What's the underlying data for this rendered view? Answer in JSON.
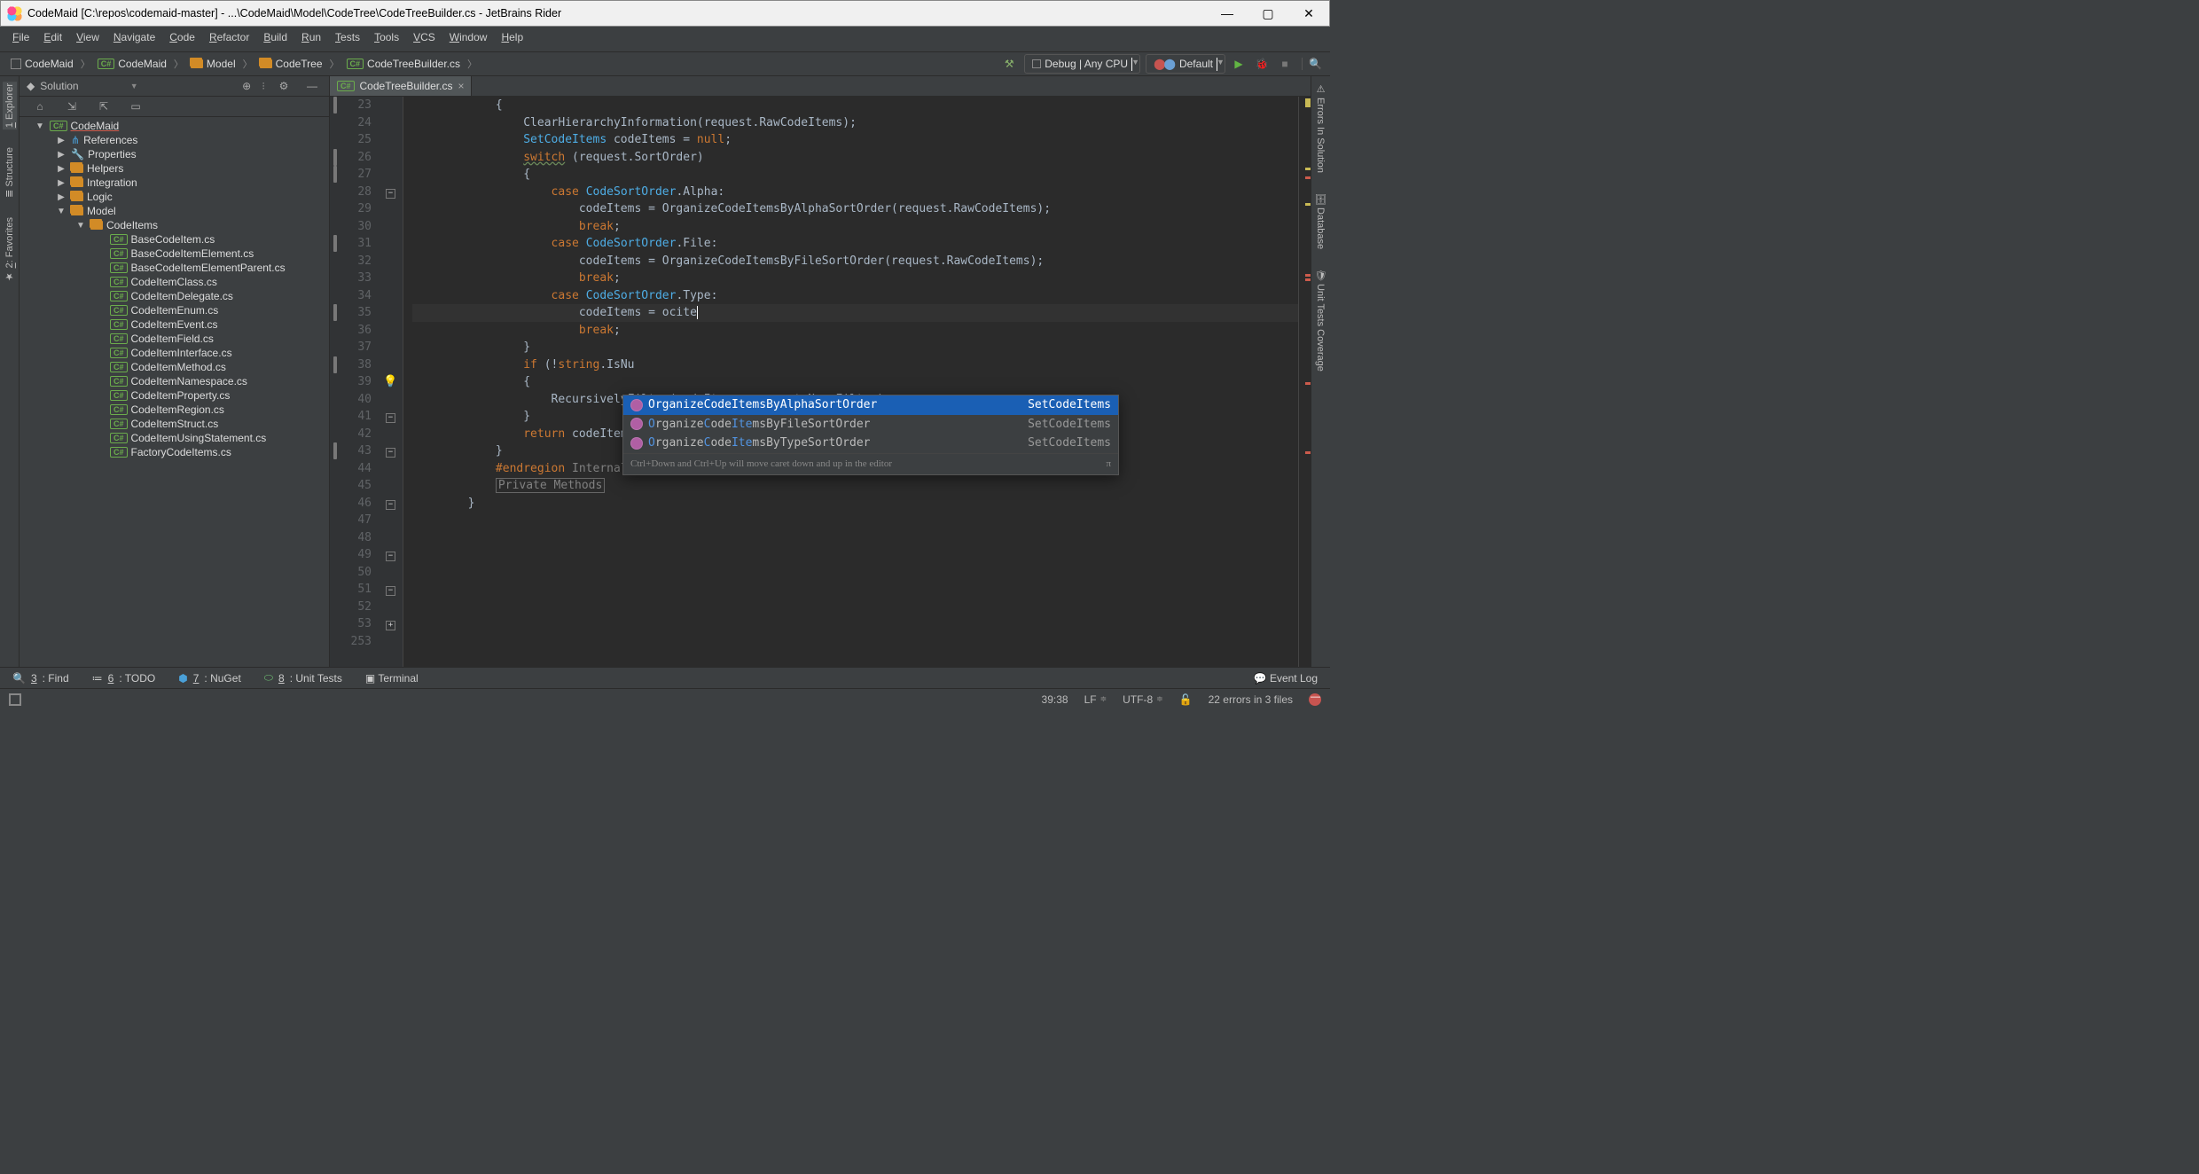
{
  "window": {
    "title": "CodeMaid [C:\\repos\\codemaid-master] - ...\\CodeMaid\\Model\\CodeTree\\CodeTreeBuilder.cs - JetBrains Rider"
  },
  "menu": [
    "File",
    "Edit",
    "View",
    "Navigate",
    "Code",
    "Refactor",
    "Build",
    "Run",
    "Tests",
    "Tools",
    "VCS",
    "Window",
    "Help"
  ],
  "breadcrumbs": [
    {
      "icon": "solution",
      "text": "CodeMaid"
    },
    {
      "icon": "cs",
      "text": "CodeMaid"
    },
    {
      "icon": "folder",
      "text": "Model"
    },
    {
      "icon": "folder",
      "text": "CodeTree"
    },
    {
      "icon": "cs",
      "text": "CodeTreeBuilder.cs"
    }
  ],
  "runconfig": {
    "config": "Debug | Any CPU",
    "profile": "Default"
  },
  "left_tools": {
    "explorer": "1: Explorer",
    "structure": "Structure",
    "favorites": "2: Favorites"
  },
  "right_tools": {
    "errors": "Errors In Solution",
    "database": "Database",
    "coverage": "Unit Tests Coverage"
  },
  "solution": {
    "title": "Solution",
    "root": "CodeMaid",
    "nodes": [
      {
        "d": 1,
        "a": "closed",
        "ico": "ref",
        "t": "References"
      },
      {
        "d": 1,
        "a": "closed",
        "ico": "prop",
        "t": "Properties"
      },
      {
        "d": 1,
        "a": "closed",
        "ico": "folder",
        "t": "Helpers"
      },
      {
        "d": 1,
        "a": "closed",
        "ico": "folder",
        "t": "Integration"
      },
      {
        "d": 1,
        "a": "closed",
        "ico": "folder",
        "t": "Logic"
      },
      {
        "d": 1,
        "a": "open",
        "ico": "folder",
        "t": "Model"
      },
      {
        "d": 2,
        "a": "open",
        "ico": "folder",
        "t": "CodeItems"
      },
      {
        "d": 3,
        "ico": "cs",
        "t": "BaseCodeItem.cs"
      },
      {
        "d": 3,
        "ico": "cs",
        "t": "BaseCodeItemElement.cs"
      },
      {
        "d": 3,
        "ico": "cs",
        "t": "BaseCodeItemElementParent.cs"
      },
      {
        "d": 3,
        "ico": "cs",
        "t": "CodeItemClass.cs"
      },
      {
        "d": 3,
        "ico": "cs",
        "t": "CodeItemDelegate.cs"
      },
      {
        "d": 3,
        "ico": "cs",
        "t": "CodeItemEnum.cs",
        "mark": true,
        "marky": 362
      },
      {
        "d": 3,
        "ico": "cs",
        "t": "CodeItemEvent.cs"
      },
      {
        "d": 3,
        "ico": "cs",
        "t": "CodeItemField.cs"
      },
      {
        "d": 3,
        "ico": "cs",
        "t": "CodeItemInterface.cs",
        "mark": true,
        "marky": 434
      },
      {
        "d": 3,
        "ico": "cs",
        "t": "CodeItemMethod.cs"
      },
      {
        "d": 3,
        "ico": "cs",
        "t": "CodeItemNamespace.cs"
      },
      {
        "d": 3,
        "ico": "cs",
        "t": "CodeItemProperty.cs"
      },
      {
        "d": 3,
        "ico": "cs",
        "t": "CodeItemRegion.cs",
        "mark": true,
        "marky": 531
      },
      {
        "d": 3,
        "ico": "cs",
        "t": "CodeItemStruct.cs"
      },
      {
        "d": 3,
        "ico": "cs",
        "t": "CodeItemUsingStatement.cs"
      },
      {
        "d": 3,
        "ico": "cs",
        "t": "FactoryCodeItems.cs"
      }
    ]
  },
  "editor": {
    "tab": "CodeTreeBuilder.cs",
    "line_numbers": [
      23,
      24,
      25,
      26,
      27,
      28,
      29,
      30,
      31,
      32,
      33,
      34,
      35,
      36,
      37,
      38,
      39,
      40,
      41,
      42,
      43,
      44,
      45,
      46,
      47,
      48,
      49,
      50,
      51,
      52,
      53,
      253
    ],
    "current_line": 39,
    "typed": "ocite"
  },
  "completion": {
    "items": [
      {
        "name": "OrganizeCodeItemsByAlphaSortOrder",
        "rtype": "SetCodeItems",
        "sel": true
      },
      {
        "name": "OrganizeCodeItemsByFileSortOrder",
        "rtype": "SetCodeItems"
      },
      {
        "name": "OrganizeCodeItemsByTypeSortOrder",
        "rtype": "SetCodeItems"
      }
    ],
    "hint": "Ctrl+Down and Ctrl+Up will move caret down and up in the editor",
    "pi": "π"
  },
  "bottom_tools": {
    "find": "3: Find",
    "todo": "6: TODO",
    "nuget": "7: NuGet",
    "unittests": "8: Unit Tests",
    "terminal": "Terminal",
    "eventlog": "Event Log"
  },
  "status": {
    "pos": "39:38",
    "lf": "LF",
    "enc": "UTF-8",
    "lock": "🔒",
    "errors": "22 errors in 3 files"
  }
}
